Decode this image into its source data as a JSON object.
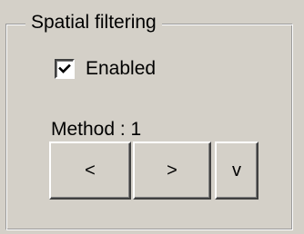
{
  "group": {
    "title": "Spatial filtering"
  },
  "enabled_checkbox": {
    "label": "Enabled",
    "checked": true
  },
  "method": {
    "label": "Method : 1"
  },
  "buttons": {
    "prev_label": "<",
    "next_label": ">",
    "menu_label": "v"
  },
  "colors": {
    "face": "#d4d0c8",
    "highlight": "#ffffff",
    "shadow": "#808080",
    "dark_shadow": "#404040"
  }
}
